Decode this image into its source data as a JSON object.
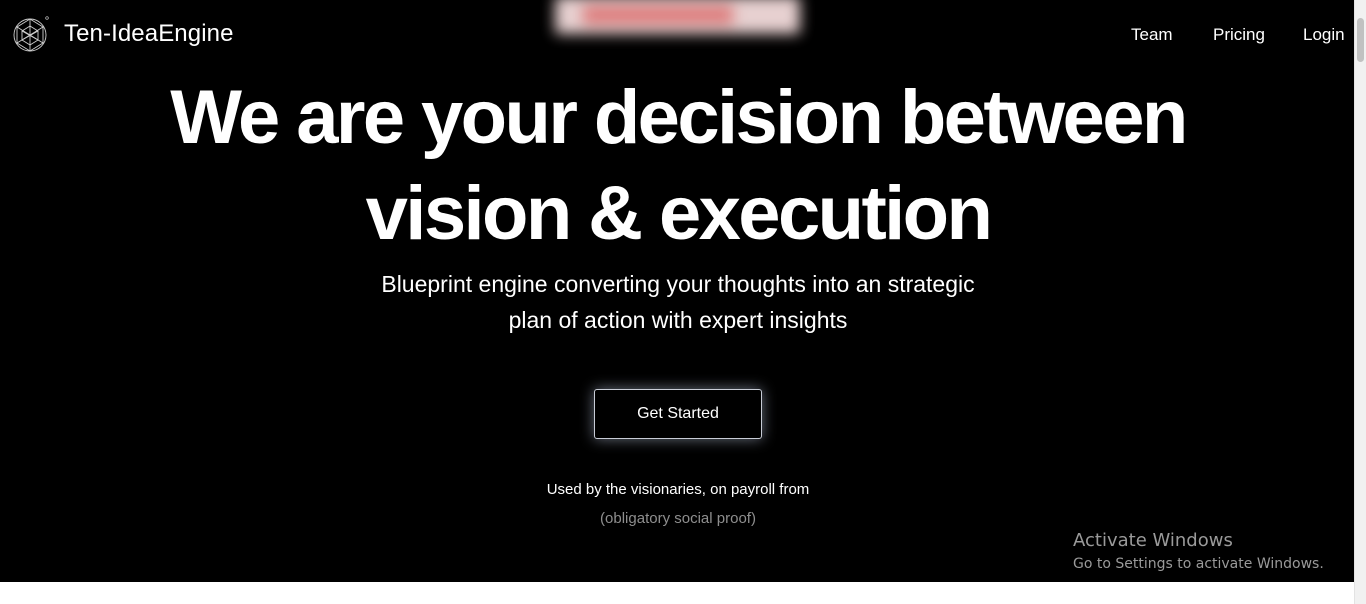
{
  "header": {
    "brand": "Ten-IdeaEngine",
    "logo_icon": "geodesic-sphere-icon",
    "nav": [
      {
        "label": "Team"
      },
      {
        "label": "Pricing"
      },
      {
        "label": "Login"
      }
    ]
  },
  "hero": {
    "headline_line1": "We are your decision between",
    "headline_line2": "vision & execution",
    "subtitle_line1": "Blueprint engine converting your thoughts into an strategic",
    "subtitle_line2": "plan of action with expert insights",
    "cta_label": "Get Started"
  },
  "social_proof": {
    "title": "Used by the visionaries, on payroll from",
    "subtitle": "(obligatory social proof)"
  },
  "windows_watermark": {
    "line1": "Activate Windows",
    "line2": "Go to Settings to activate Windows."
  },
  "colors": {
    "hero_background": "#000000",
    "text": "#ffffff",
    "muted": "#8e8e8e",
    "page_background": "#ffffff"
  }
}
